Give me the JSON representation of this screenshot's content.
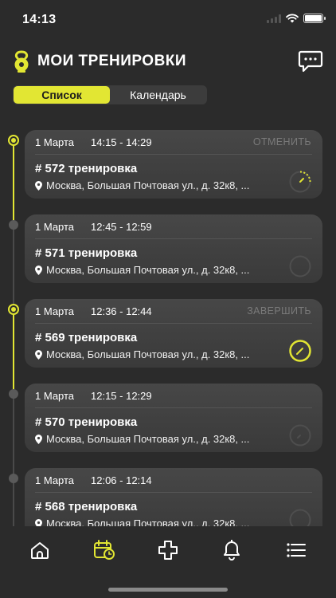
{
  "status_bar": {
    "time": "14:13"
  },
  "header": {
    "title": "МОИ ТРЕНИРОВКИ"
  },
  "segment": {
    "tabs": [
      {
        "label": "Список",
        "active": true
      },
      {
        "label": "Календарь",
        "active": false
      }
    ]
  },
  "workouts": [
    {
      "date": "1 Марта",
      "time": "14:15 - 14:29",
      "action": "ОТМЕНИТЬ",
      "title": "# 572 тренировка",
      "address": "Москва, Большая Почтовая ул., д. 32к8, ...",
      "status": "in-progress",
      "timeline": "active"
    },
    {
      "date": "1 Марта",
      "time": "12:45 - 12:59",
      "action": "",
      "title": "# 571 тренировка",
      "address": "Москва, Большая Почтовая ул., д. 32к8, ...",
      "status": "inactive",
      "timeline": "inactive"
    },
    {
      "date": "1 Марта",
      "time": "12:36 - 12:44",
      "action": "ЗАВЕРШИТЬ",
      "title": "# 569 тренировка",
      "address": "Москва, Большая Почтовая ул., д. 32к8, ...",
      "status": "active",
      "timeline": "active"
    },
    {
      "date": "1 Марта",
      "time": "12:15 - 12:29",
      "action": "",
      "title": "# 570 тренировка",
      "address": "Москва, Большая Почтовая ул., д. 32к8, ...",
      "status": "inactive",
      "timeline": "inactive"
    },
    {
      "date": "1 Марта",
      "time": "12:06 - 12:14",
      "action": "",
      "title": "# 568 тренировка",
      "address": "Москва, Большая Почтовая ул., д. 32к8, ...",
      "status": "inactive",
      "timeline": "inactive"
    }
  ],
  "tabbar": {
    "items": [
      "home-icon",
      "calendar-icon",
      "plus-icon",
      "bell-icon",
      "menu-icon"
    ],
    "active": "calendar-icon"
  },
  "colors": {
    "accent": "#e2e633",
    "background": "#2b2b2b",
    "card": "#424242",
    "muted": "#7a7a7a"
  }
}
